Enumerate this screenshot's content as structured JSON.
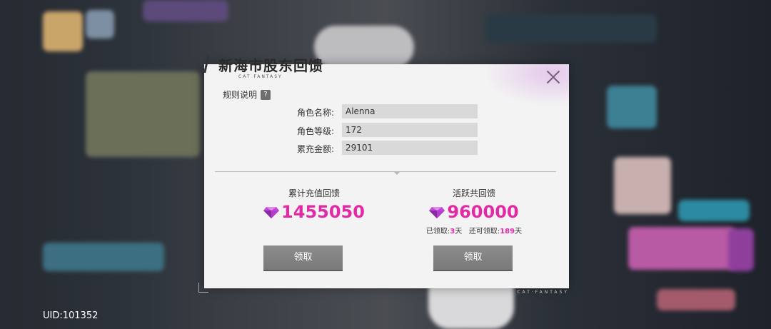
{
  "dialog": {
    "title": "新海市股东回馈",
    "subtitle": "CAT FANTASY",
    "rules_label": "规则说明",
    "rules_icon": "?",
    "fields": [
      {
        "label": "角色名称:",
        "value": "Alenna"
      },
      {
        "label": "角色等级:",
        "value": "172"
      },
      {
        "label": "累充金额:",
        "value": "29101"
      }
    ],
    "left_panel": {
      "label": "累计充值回馈",
      "amount": "1455050",
      "button_label": "领取"
    },
    "right_panel": {
      "label": "活跃共回馈",
      "amount": "960000",
      "claimed_prefix": "已领取:",
      "claimed_days": "3",
      "claimed_unit": "天",
      "remaining_prefix": "还可领取:",
      "remaining_days": "189",
      "remaining_unit": "天",
      "button_label": "领取"
    },
    "brand": "CAT·FANTASY"
  },
  "footer": {
    "uid": "UID:101352"
  },
  "colors": {
    "accent": "#e22aa6",
    "button": "#7f7f7f",
    "field_bg": "#d9d9d9"
  }
}
